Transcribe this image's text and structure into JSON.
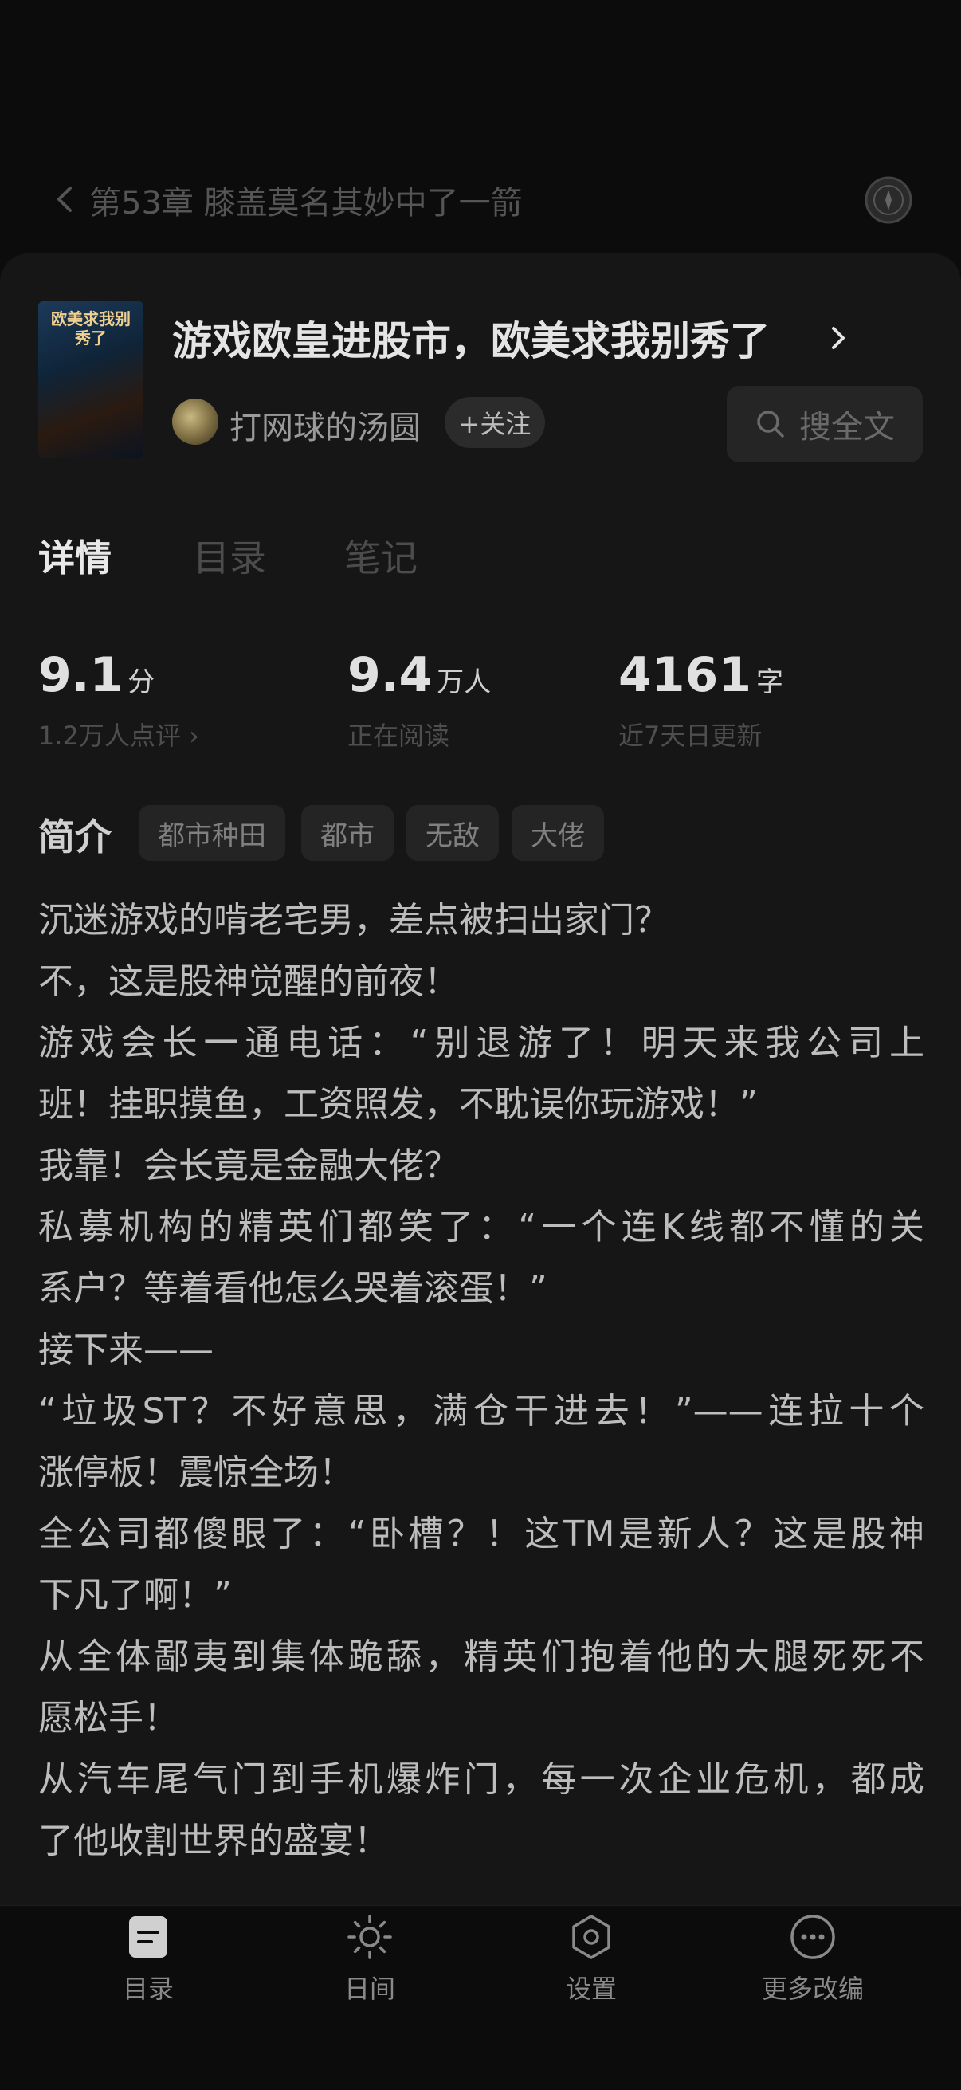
{
  "header": {
    "chapter_title": "第53章 膝盖莫名其妙中了一箭"
  },
  "book": {
    "title": "游戏欧皇进股市，欧美求我别秀了",
    "cover_text": "欧美求我别秀了",
    "author": "打网球的汤圆",
    "follow_label": "+关注",
    "search_label": "搜全文"
  },
  "tabs": [
    "详情",
    "目录",
    "笔记"
  ],
  "stats": [
    {
      "value": "9.1",
      "unit": "分",
      "sub": "1.2万人点评 ›"
    },
    {
      "value": "9.4",
      "unit": "万人",
      "sub": "正在阅读"
    },
    {
      "value": "4161",
      "unit": "字",
      "sub": "近7天日更新"
    }
  ],
  "intro": {
    "label": "简介",
    "tags": [
      "都市种田",
      "都市",
      "无敌",
      "大佬"
    ],
    "lines": [
      "沉迷游戏的啃老宅男，差点被扫出家门？",
      "不，这是股神觉醒的前夜！",
      "游戏会长一通电话：“别退游了！明天来我公司上",
      "班！挂职摸鱼，工资照发，不耽误你玩游戏！”",
      "我靠！会长竟是金融大佬？",
      "私募机构的精英们都笑了：“一个连K线都不懂的关",
      "系户？等着看他怎么哭着滚蛋！”",
      "接下来——",
      "“垃圾ST？不好意思，满仓干进去！”——连拉十个",
      "涨停板！震惊全场！",
      "全公司都傻眼了：“卧槽？！这TM是新人？这是股神",
      "下凡了啊！”",
      "从全体鄙夷到集体跪舔，精英们抱着他的大腿死死不",
      "愿松手！",
      "从汽车尾气门到手机爆炸门，每一次企业危机，都成",
      "了他收割世界的盛宴！"
    ]
  },
  "bottom_nav": [
    "目录",
    "日间",
    "设置",
    "更多改编"
  ]
}
